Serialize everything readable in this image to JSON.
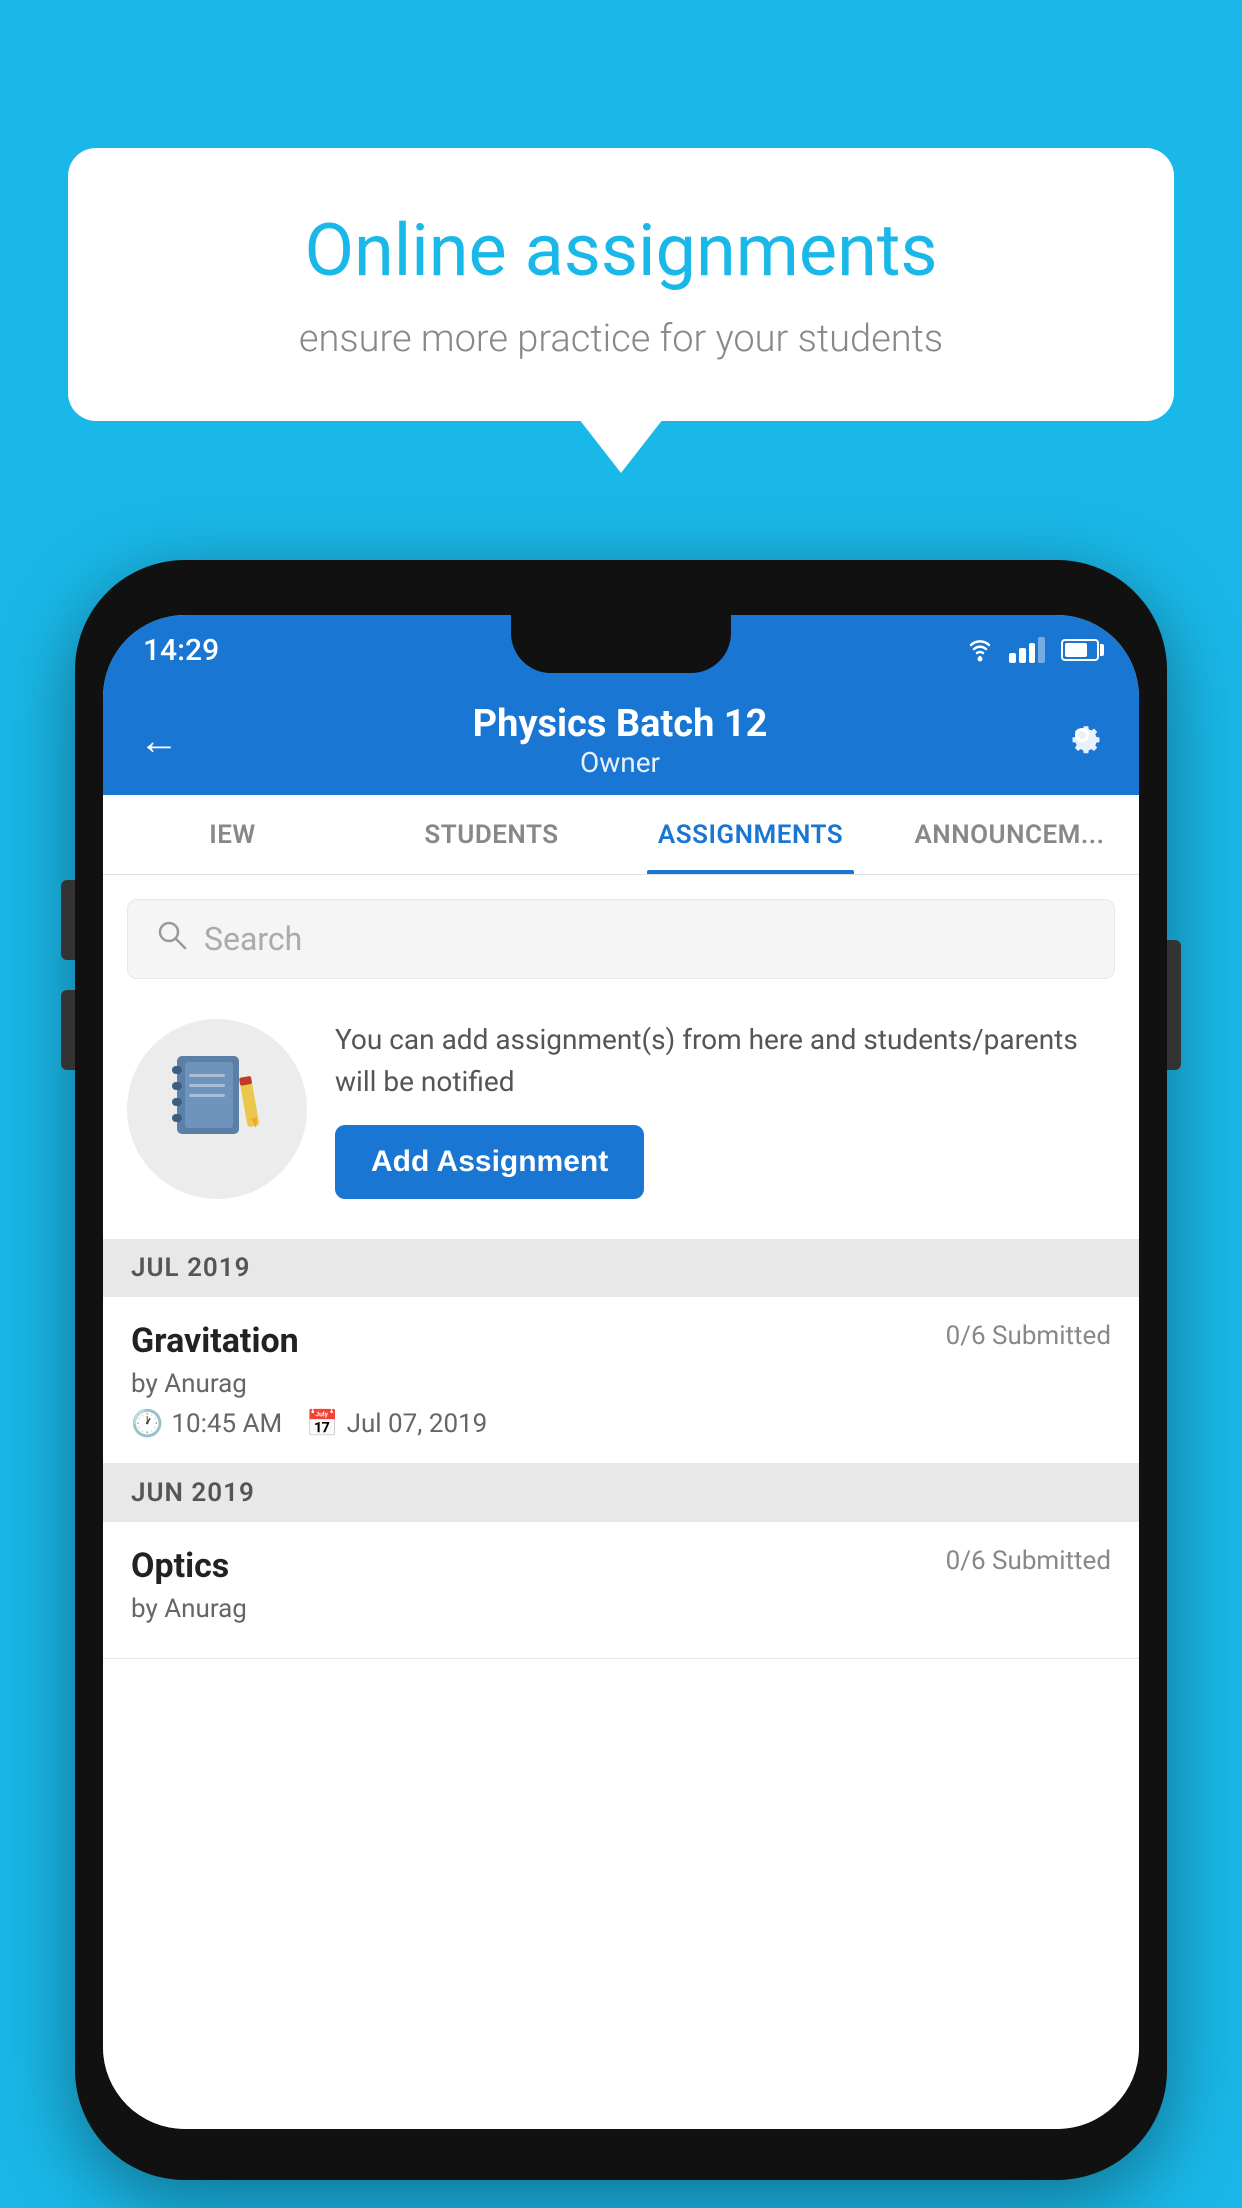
{
  "background": {
    "color": "#1ab8e8"
  },
  "speech_bubble": {
    "title": "Online assignments",
    "subtitle": "ensure more practice for your students"
  },
  "status_bar": {
    "time": "14:29"
  },
  "header": {
    "title": "Physics Batch 12",
    "subtitle": "Owner",
    "back_label": "←",
    "settings_label": "⚙"
  },
  "tabs": [
    {
      "label": "IEW",
      "active": false
    },
    {
      "label": "STUDENTS",
      "active": false
    },
    {
      "label": "ASSIGNMENTS",
      "active": true
    },
    {
      "label": "ANNOUNCEM...",
      "active": false
    }
  ],
  "search": {
    "placeholder": "Search"
  },
  "empty_state": {
    "description": "You can add assignment(s) from here and students/parents will be notified",
    "add_button": "Add Assignment"
  },
  "sections": [
    {
      "month": "JUL 2019",
      "assignments": [
        {
          "name": "Gravitation",
          "submitted": "0/6 Submitted",
          "author": "by Anurag",
          "time": "10:45 AM",
          "date": "Jul 07, 2019"
        }
      ]
    },
    {
      "month": "JUN 2019",
      "assignments": [
        {
          "name": "Optics",
          "submitted": "0/6 Submitted",
          "author": "by Anurag",
          "time": "",
          "date": ""
        }
      ]
    }
  ]
}
